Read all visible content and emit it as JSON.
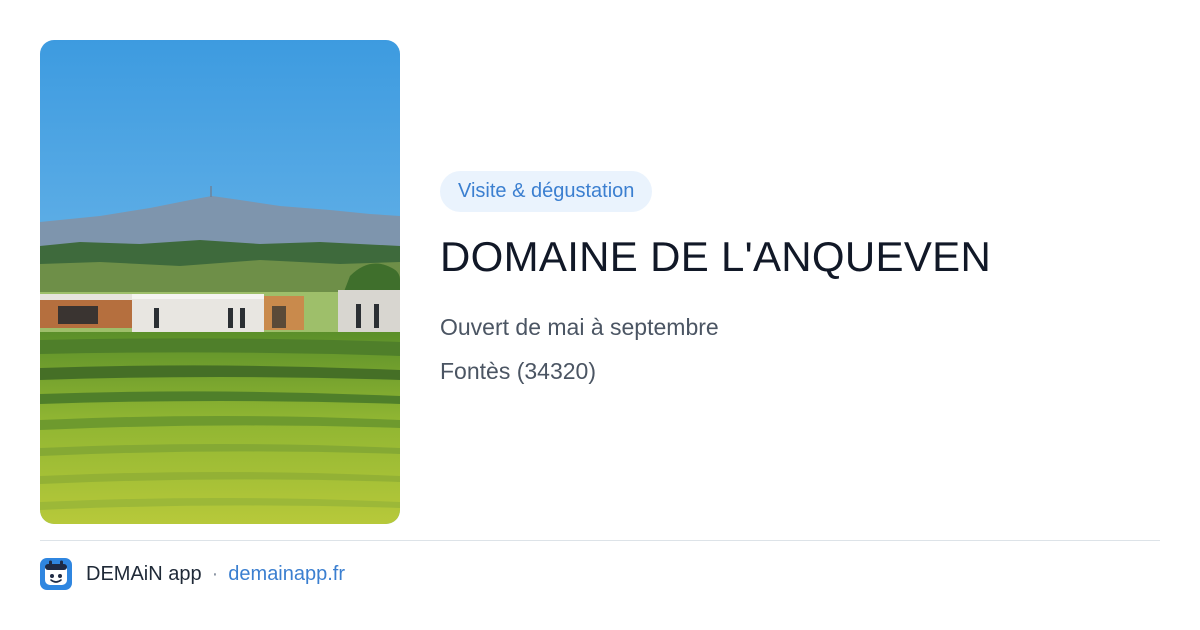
{
  "colors": {
    "accent": "#3b7fd0",
    "tag_background": "#eaf3fd",
    "title": "#111827",
    "detail": "#4b5563",
    "divider": "#dde3e8"
  },
  "image": {
    "subject": "vineyard-estate-photo"
  },
  "info": {
    "tag": "Visite & dégustation",
    "title": "DOMAINE DE L'ANQUEVEN",
    "opening": "Ouvert de mai à septembre",
    "location": "Fontès (34320)"
  },
  "footer": {
    "icon": "demain-app-icon",
    "app_name": "DEMAiN app",
    "separator": "·",
    "link": "demainapp.fr"
  }
}
